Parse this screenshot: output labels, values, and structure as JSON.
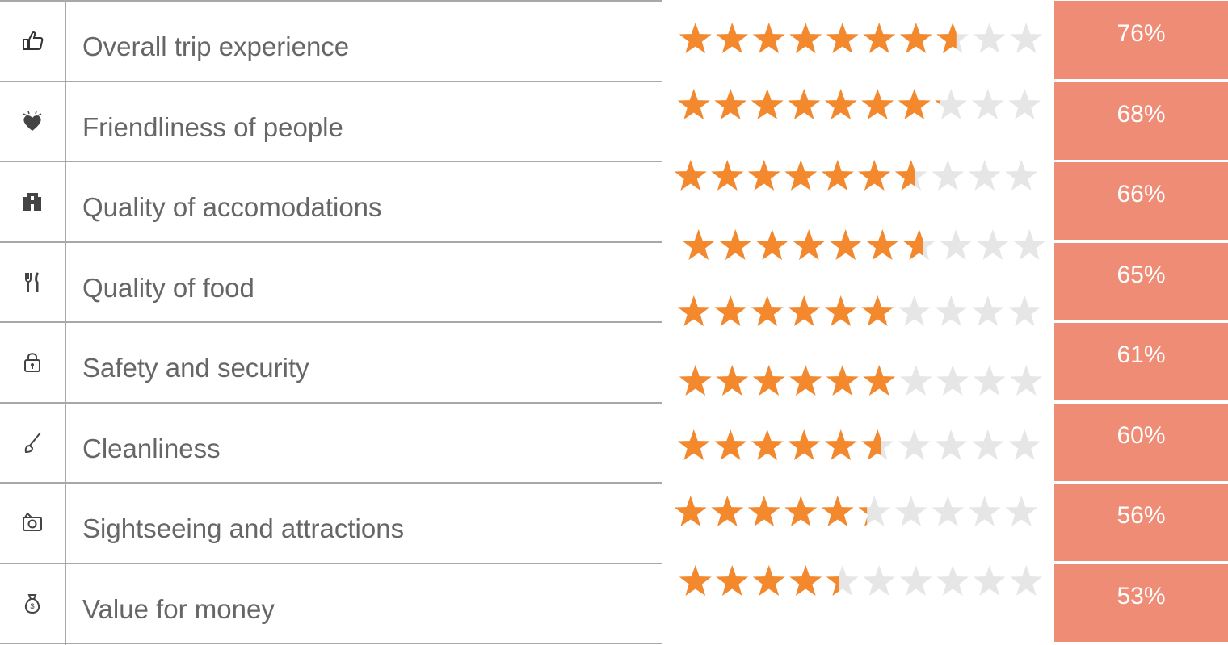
{
  "colors": {
    "star_filled": "#f3882d",
    "star_empty": "#e6e6e6",
    "percent_bg": "#ee8c76",
    "grid": "#a8a8a8",
    "label_text": "#666666"
  },
  "chart_data": {
    "type": "table",
    "stars_max": 10,
    "rows": [
      {
        "label": "Overall trip experience",
        "icon": "thumbs-up-icon",
        "percent": "76%",
        "value": 76
      },
      {
        "label": "Friendliness of people",
        "icon": "heart-icon",
        "percent": "68%",
        "value": 68
      },
      {
        "label": "Quality of accomodations",
        "icon": "hotel-icon",
        "percent": "66%",
        "value": 66
      },
      {
        "label": "Quality of food",
        "icon": "fork-knife-icon",
        "percent": "65%",
        "value": 65
      },
      {
        "label": "Safety and security",
        "icon": "lock-icon",
        "percent": "61%",
        "value": 61
      },
      {
        "label": "Cleanliness",
        "icon": "brush-icon",
        "percent": "60%",
        "value": 60
      },
      {
        "label": "Sightseeing and attractions",
        "icon": "camera-icon",
        "percent": "56%",
        "value": 56
      },
      {
        "label": "Value for money",
        "icon": "money-bag-icon",
        "percent": "53%",
        "value": 53
      }
    ],
    "star_rows": [
      7.6,
      7.2,
      6.6,
      6.6,
      6.0,
      6.0,
      5.6,
      5.3,
      4.4
    ]
  }
}
